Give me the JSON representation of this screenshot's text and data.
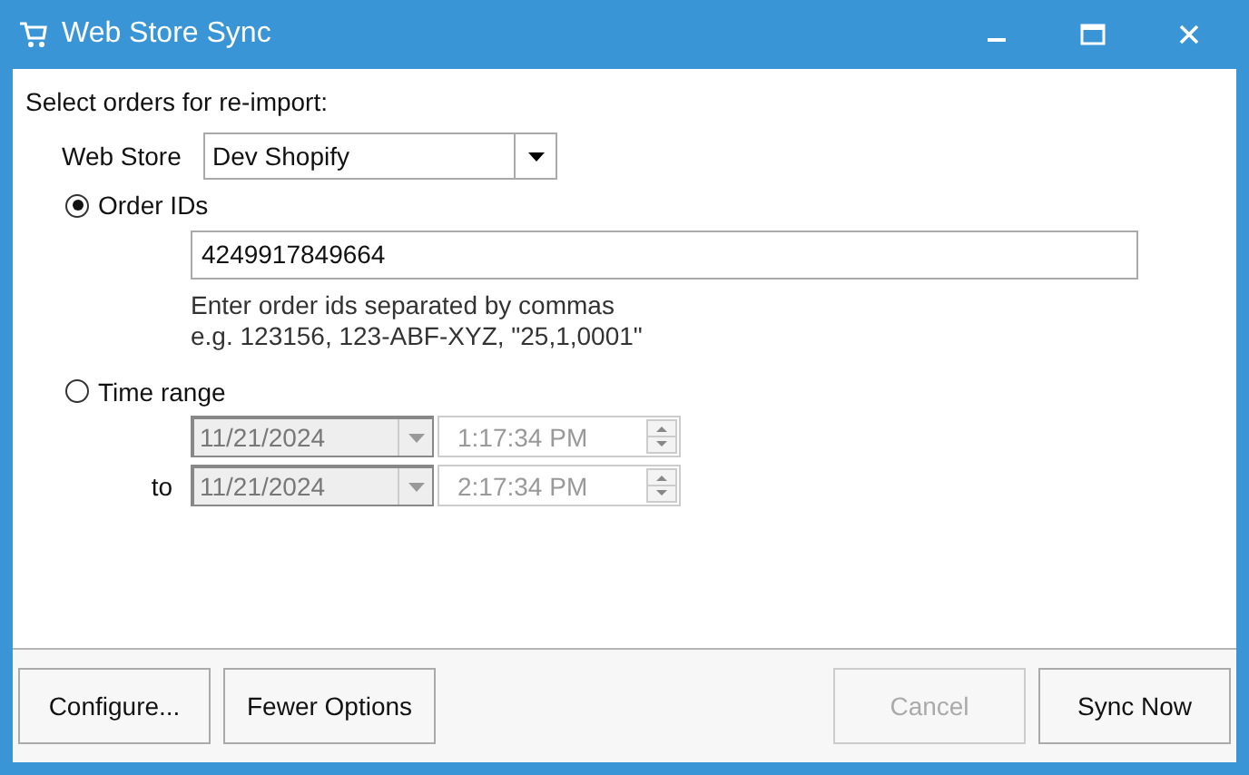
{
  "window": {
    "title": "Web Store Sync"
  },
  "prompt": "Select orders for re-import:",
  "web_store": {
    "label": "Web Store",
    "value": "Dev Shopify"
  },
  "order_ids": {
    "label": "Order IDs",
    "selected": true,
    "value": "4249917849664",
    "hint_lines": [
      "Enter order ids separated by commas",
      "e.g. 123156, 123-ABF-XYZ, \"25,1,0001\""
    ]
  },
  "time_range": {
    "label": "Time range",
    "selected": false,
    "rows": [
      {
        "date": "11/21/2024",
        "time": "1:17:34 PM",
        "disabled": true
      },
      {
        "label": "to",
        "date": "11/21/2024",
        "time": "2:17:34 PM",
        "disabled": true
      }
    ]
  },
  "left_buttons": [
    {
      "label": "Configure...",
      "disabled": false
    },
    {
      "label": "Fewer Options",
      "disabled": false
    }
  ],
  "right_buttons": [
    {
      "label": "Cancel",
      "disabled": true
    },
    {
      "label": "Sync Now",
      "disabled": false
    }
  ]
}
